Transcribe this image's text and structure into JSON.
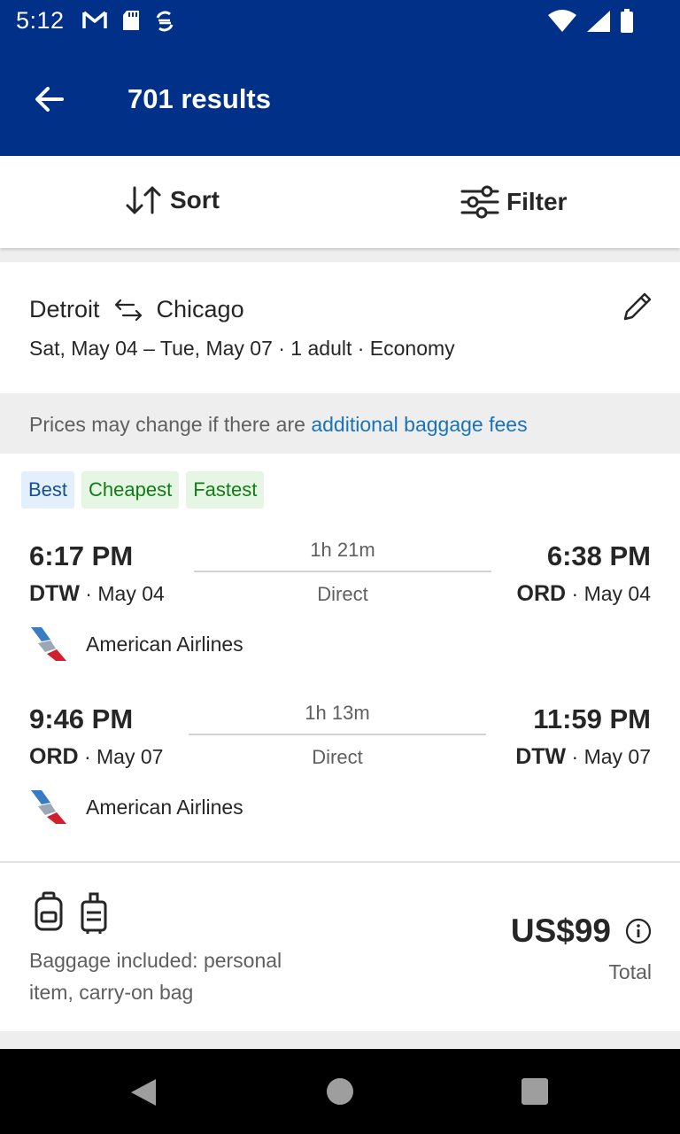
{
  "status_bar": {
    "time": "5:12",
    "icons": [
      "gmail-icon",
      "sd-card-icon",
      "sync-icon",
      "wifi-icon",
      "signal-icon",
      "battery-icon"
    ]
  },
  "app_bar": {
    "title": "701 results",
    "back_icon": "arrow-left-icon",
    "background": "#003087"
  },
  "toolbar": {
    "sort_label": "Sort",
    "filter_label": "Filter"
  },
  "search": {
    "origin": "Detroit",
    "destination": "Chicago",
    "details": "Sat, May 04 – Tue, May 07 · 1 adult · Economy"
  },
  "notice": {
    "text": "Prices may change if there are ",
    "link": "additional baggage fees"
  },
  "result": {
    "tags": [
      "Best",
      "Cheapest",
      "Fastest"
    ],
    "legs": [
      {
        "depart_time": "6:17 PM",
        "depart_code": "DTW",
        "depart_date": "May 04",
        "duration": "1h 21m",
        "stops": "Direct",
        "arrive_time": "6:38 PM",
        "arrive_code": "ORD",
        "arrive_date": "May 04",
        "airline": "American Airlines"
      },
      {
        "depart_time": "9:46 PM",
        "depart_code": "ORD",
        "depart_date": "May 07",
        "duration": "1h 13m",
        "stops": "Direct",
        "arrive_time": "11:59 PM",
        "arrive_code": "DTW",
        "arrive_date": "May 07",
        "airline": "American Airlines"
      }
    ],
    "baggage_text": "Baggage included: personal item, carry-on bag",
    "price": "US$99",
    "price_caption": "Total"
  },
  "colors": {
    "brand": "#003087",
    "link": "#1a73b8",
    "best_tag": "#174f94",
    "green_tag": "#137b16"
  }
}
